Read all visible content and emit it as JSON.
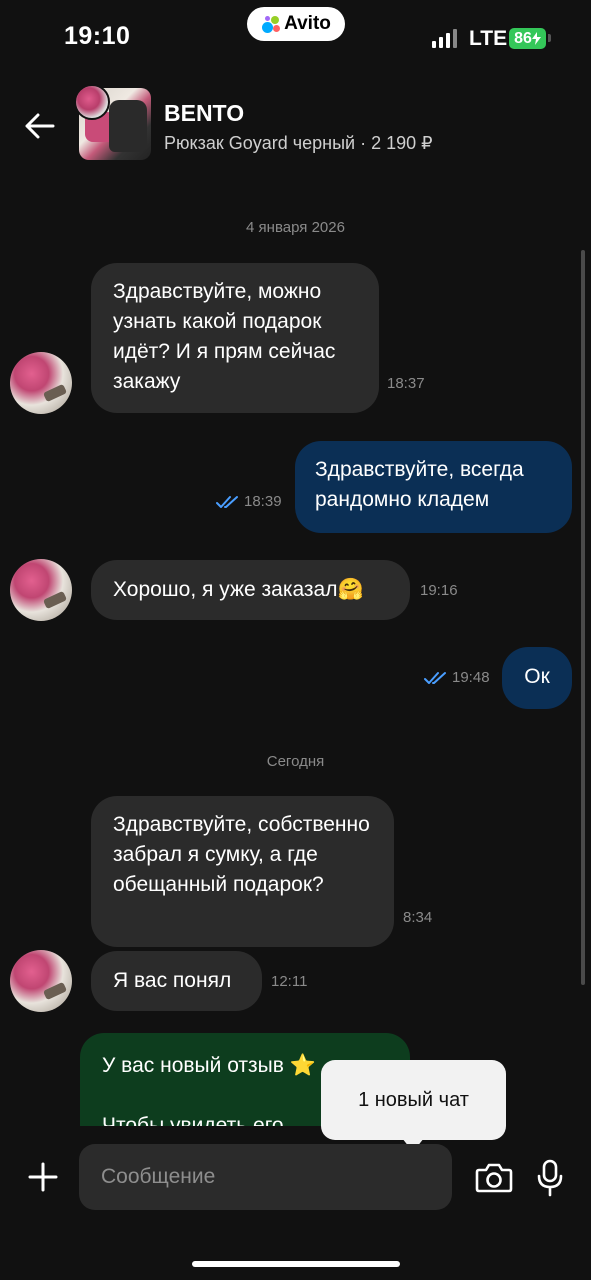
{
  "status_bar": {
    "time": "19:10",
    "app_badge": "Avito",
    "network": "LTE",
    "battery": "86"
  },
  "header": {
    "seller_name": "BENTO",
    "product": "Рюкзак Goyard черный · 2 190 ₽"
  },
  "dates": {
    "first": "4 января 2026",
    "today": "Сегодня"
  },
  "messages": [
    {
      "direction": "in",
      "text": "Здравствуйте, можно узнать какой подарок идёт? И я прям сейчас закажу",
      "time": "18:37"
    },
    {
      "direction": "out",
      "text": "Здравствуйте, всегда рандомно кладем",
      "time": "18:39"
    },
    {
      "direction": "in",
      "text": "Хорошо, я уже заказал🤗",
      "time": "19:16"
    },
    {
      "direction": "out",
      "text": "Ок",
      "time": "19:48"
    },
    {
      "direction": "in",
      "text": "Здравствуйте, собственно забрал я сумку, а где обещанный подарок?",
      "time": "8:34"
    },
    {
      "direction": "in",
      "text": "Я вас понял",
      "time": "12:11"
    }
  ],
  "review_card": {
    "line1": "У вас новый отзыв ⭐",
    "line2": "Чтобы увидеть его"
  },
  "tooltip": {
    "text": "1 новый чат"
  },
  "composer": {
    "placeholder": "Сообщение"
  },
  "colors": {
    "background": "#111111",
    "incoming_bubble": "#2b2b2b",
    "outgoing_bubble": "#0b2f55",
    "read_check": "#4a9eff",
    "review_card": "#0d3d1e"
  }
}
